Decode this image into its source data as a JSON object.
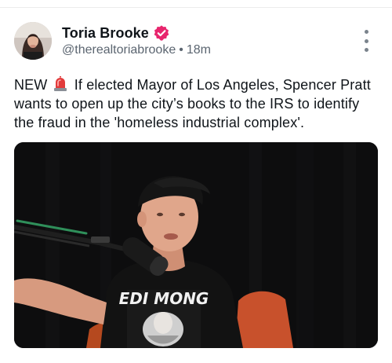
{
  "author": {
    "display_name": "Toria Brooke",
    "handle": "@therealtoriabrooke",
    "time_ago": "18m",
    "verified_icon": "verified-badge-icon",
    "badge_color": "#e8256d"
  },
  "post": {
    "text_before": "NEW",
    "text_after": "If elected Mayor of Los Angeles, Spencer Pratt wants to open up the city’s books to the IRS to identify the fraud in the 'homeless industrial complex'.",
    "emoji_icon": "police-light-icon"
  },
  "media": {
    "shirt_text": "EDI MONG"
  },
  "menu": {
    "icon": "more-vertical-icon"
  }
}
